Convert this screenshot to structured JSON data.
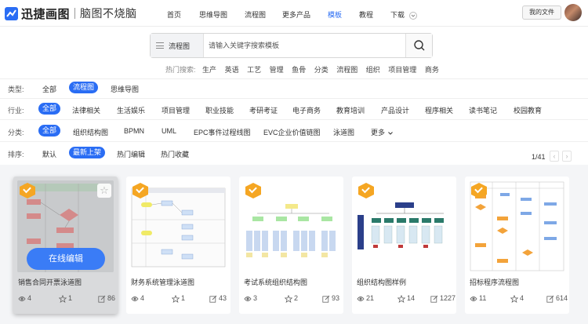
{
  "header": {
    "logo_text": "迅捷画图",
    "slogan": "脑图不烧脑",
    "nav": [
      {
        "label": "首页"
      },
      {
        "label": "思维导图"
      },
      {
        "label": "流程图"
      },
      {
        "label": "更多产品"
      },
      {
        "label": "模板"
      },
      {
        "label": "教程"
      },
      {
        "label": "下载"
      }
    ],
    "my_files_label": "我的文件"
  },
  "search": {
    "category": "流程图",
    "placeholder": "请输入关键字搜索模板",
    "hot_label": "热门搜索:",
    "hot_terms": [
      "生产",
      "英语",
      "工艺",
      "管理",
      "鱼骨",
      "分类",
      "流程图",
      "组织",
      "项目管理",
      "商务"
    ]
  },
  "filters": {
    "type": {
      "label": "类型:",
      "options": [
        "全部",
        "流程图",
        "思维导图"
      ],
      "selected": "流程图"
    },
    "industry": {
      "label": "行业:",
      "options": [
        "全部",
        "法律相关",
        "生活娱乐",
        "项目管理",
        "职业技能",
        "考研考证",
        "电子商务",
        "教育培训",
        "产品设计",
        "程序相关",
        "读书笔记",
        "校园教育"
      ],
      "selected": "全部"
    },
    "category": {
      "label": "分类:",
      "options": [
        "全部",
        "组织结构图",
        "BPMN",
        "UML",
        "EPC事件过程线图",
        "EVC企业价值链图",
        "泳道图",
        "更多"
      ],
      "selected": "全部"
    },
    "sort": {
      "label": "排序:",
      "options": [
        "默认",
        "最新上架",
        "热门编辑",
        "热门收藏"
      ],
      "selected": "最新上架"
    }
  },
  "pagination": {
    "text": "1/41",
    "prev": "‹",
    "next": "›"
  },
  "cards": [
    {
      "title": "销售合同开票泳道图",
      "views": "4",
      "stars": "1",
      "edits": "86",
      "hovered": true,
      "edit_label": "在线编辑",
      "star_icon": "☆"
    },
    {
      "title": "财务系统管理泳道图",
      "views": "4",
      "stars": "1",
      "edits": "43"
    },
    {
      "title": "考试系统组织结构图",
      "views": "3",
      "stars": "2",
      "edits": "93"
    },
    {
      "title": "组织结构图样例",
      "views": "21",
      "stars": "14",
      "edits": "1227"
    },
    {
      "title": "招标程序流程图",
      "views": "11",
      "stars": "4",
      "edits": "614"
    }
  ],
  "colors": {
    "accent": "#2a6df4",
    "badge": "#f5a623",
    "edit_button": "#3a7cf6"
  }
}
